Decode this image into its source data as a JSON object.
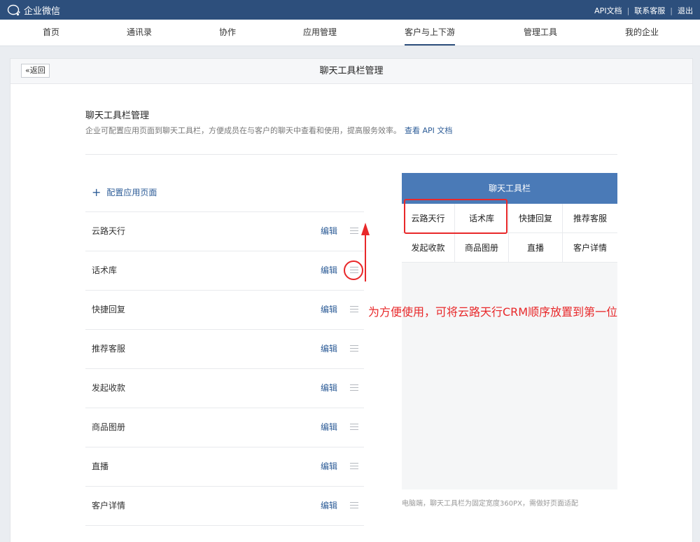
{
  "app": {
    "title": "企业微信"
  },
  "top_links": [
    "API文档",
    "联系客服",
    "退出"
  ],
  "nav": {
    "items": [
      "首页",
      "通讯录",
      "协作",
      "应用管理",
      "客户与上下游",
      "管理工具",
      "我的企业"
    ],
    "active": "客户与上下游"
  },
  "panel": {
    "back_label": "返回",
    "title": "聊天工具栏管理"
  },
  "section": {
    "title": "聊天工具栏管理",
    "description": "企业可配置应用页面到聊天工具栏，方便成员在与客户的聊天中查看和使用，提高服务效率。",
    "api_link": "查看 API 文档"
  },
  "add_label": "配置应用页面",
  "rows": [
    {
      "name": "云路天行",
      "edit": "编辑"
    },
    {
      "name": "话术库",
      "edit": "编辑"
    },
    {
      "name": "快捷回复",
      "edit": "编辑"
    },
    {
      "name": "推荐客服",
      "edit": "编辑"
    },
    {
      "name": "发起收款",
      "edit": "编辑"
    },
    {
      "name": "商品图册",
      "edit": "编辑"
    },
    {
      "name": "直播",
      "edit": "编辑"
    },
    {
      "name": "客户详情",
      "edit": "编辑"
    }
  ],
  "preview": {
    "title": "聊天工具栏",
    "items": [
      "云路天行",
      "话术库",
      "快捷回复",
      "推荐客服",
      "发起收款",
      "商品图册",
      "直播",
      "客户详情"
    ],
    "note": "电脑端，聊天工具栏为固定宽度360PX，需做好页面适配"
  },
  "annotation": {
    "text": "为方便使用，可将云路天行CRM顺序放置到第一位",
    "color": "#e8282a"
  },
  "colors": {
    "topbar": "#2d4f7c",
    "preview_header": "#4a7ab7",
    "link": "#2d5c97"
  }
}
